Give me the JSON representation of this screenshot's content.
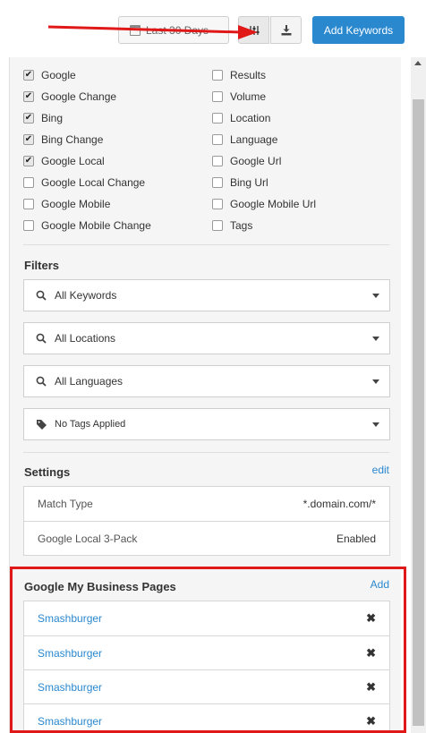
{
  "toolbar": {
    "date_range_label": "Last 30 Days",
    "add_keywords_label": "Add Keywords"
  },
  "columns": {
    "left": [
      {
        "label": "Google",
        "checked": true
      },
      {
        "label": "Google Change",
        "checked": true
      },
      {
        "label": "Bing",
        "checked": true
      },
      {
        "label": "Bing Change",
        "checked": true
      },
      {
        "label": "Google Local",
        "checked": true
      },
      {
        "label": "Google Local Change",
        "checked": false
      },
      {
        "label": "Google Mobile",
        "checked": false
      },
      {
        "label": "Google Mobile Change",
        "checked": false
      }
    ],
    "right": [
      {
        "label": "Results",
        "checked": false
      },
      {
        "label": "Volume",
        "checked": false
      },
      {
        "label": "Location",
        "checked": false
      },
      {
        "label": "Language",
        "checked": false
      },
      {
        "label": "Google Url",
        "checked": false
      },
      {
        "label": "Bing Url",
        "checked": false
      },
      {
        "label": "Google Mobile Url",
        "checked": false
      },
      {
        "label": "Tags",
        "checked": false
      }
    ]
  },
  "filters": {
    "title": "Filters",
    "keywords": "All Keywords",
    "locations": "All Locations",
    "languages": "All Languages",
    "tags": "No Tags Applied"
  },
  "settings": {
    "title": "Settings",
    "edit_label": "edit",
    "rows": [
      {
        "key": "Match Type",
        "value": "*.domain.com/*"
      },
      {
        "key": "Google Local 3-Pack",
        "value": "Enabled"
      }
    ]
  },
  "gmb": {
    "title": "Google My Business Pages",
    "add_label": "Add",
    "pages": [
      {
        "name": "Smashburger",
        "remove": "✖"
      },
      {
        "name": "Smashburger",
        "remove": "✖"
      },
      {
        "name": "Smashburger",
        "remove": "✖"
      },
      {
        "name": "Smashburger",
        "remove": "✖"
      }
    ]
  },
  "icons": {
    "calendar": "calendar-icon",
    "settings": "sliders-icon",
    "download": "download-icon",
    "search": "search-icon",
    "tag": "tag-icon"
  },
  "colors": {
    "accent": "#2a88cf",
    "annotation": "#e01818"
  }
}
